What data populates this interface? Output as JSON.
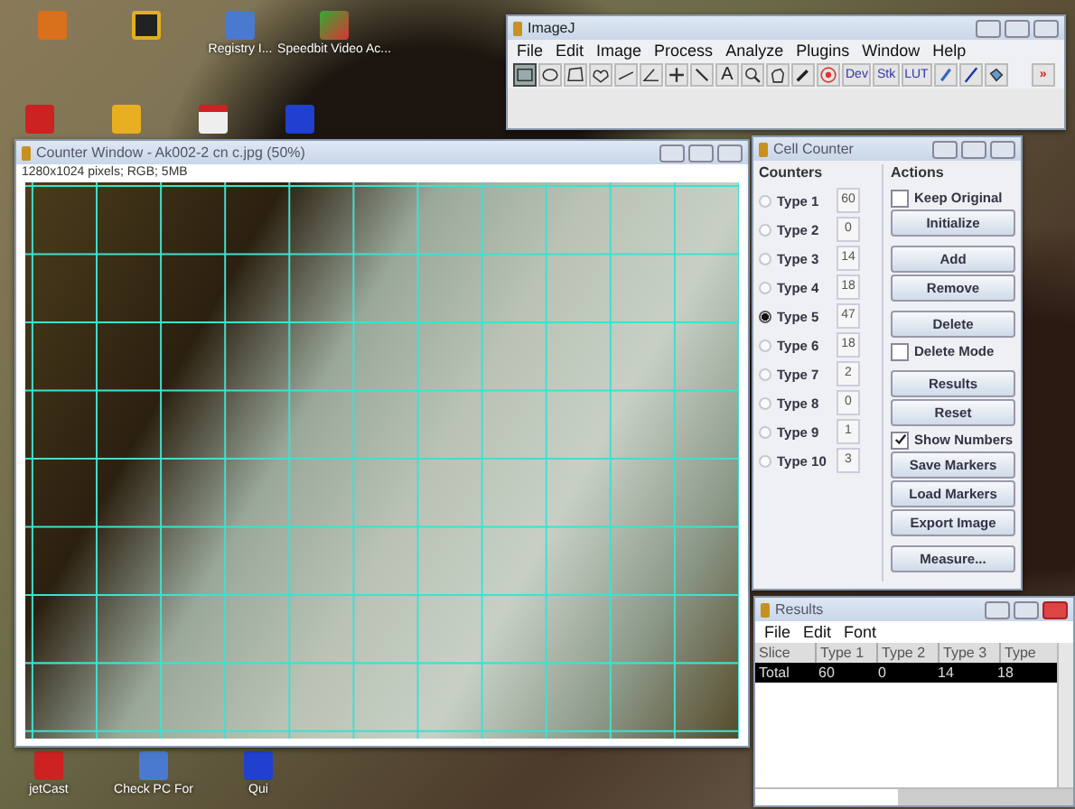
{
  "desktop": {
    "top_icons": [
      {
        "label": "Registry I..."
      },
      {
        "label": "Speedbit Video Ac..."
      }
    ],
    "bottom_icons": [
      {
        "label": "jetCast"
      },
      {
        "label": "Check PC For"
      },
      {
        "label": "Qui"
      }
    ]
  },
  "imagej": {
    "title": "ImageJ",
    "menu": [
      "File",
      "Edit",
      "Image",
      "Process",
      "Analyze",
      "Plugins",
      "Window",
      "Help"
    ],
    "tools": [
      {
        "kind": "rect",
        "selected": true
      },
      {
        "kind": "oval",
        "selected": false
      },
      {
        "kind": "polygon",
        "selected": false
      },
      {
        "kind": "freehand",
        "selected": false
      },
      {
        "kind": "line",
        "selected": false
      },
      {
        "kind": "angle",
        "selected": false
      },
      {
        "kind": "point",
        "selected": false
      },
      {
        "kind": "wand",
        "selected": false
      },
      {
        "kind": "text",
        "label": "A",
        "selected": false
      },
      {
        "kind": "zoom",
        "selected": false
      },
      {
        "kind": "hand",
        "selected": false
      },
      {
        "kind": "dropper",
        "selected": false
      },
      {
        "kind": "target",
        "selected": false
      },
      {
        "kind": "menu",
        "label": "Dev",
        "selected": false
      },
      {
        "kind": "menu",
        "label": "Stk",
        "selected": false
      },
      {
        "kind": "menu",
        "label": "LUT",
        "selected": false
      },
      {
        "kind": "brush",
        "selected": false
      },
      {
        "kind": "pen",
        "selected": false
      },
      {
        "kind": "bucket",
        "selected": false
      },
      {
        "kind": "more",
        "label": "»",
        "selected": false
      }
    ]
  },
  "image_window": {
    "title": "Counter Window - Ak002-2 cn c.jpg (50%)",
    "info": "1280x1024 pixels; RGB; 5MB"
  },
  "cell_counter": {
    "title": "Cell Counter",
    "counters_heading": "Counters",
    "actions_heading": "Actions",
    "counters": [
      {
        "label": "Type 1",
        "count": "60",
        "selected": false
      },
      {
        "label": "Type 2",
        "count": "0",
        "selected": false
      },
      {
        "label": "Type 3",
        "count": "14",
        "selected": false
      },
      {
        "label": "Type 4",
        "count": "18",
        "selected": false
      },
      {
        "label": "Type 5",
        "count": "47",
        "selected": true
      },
      {
        "label": "Type 6",
        "count": "18",
        "selected": false
      },
      {
        "label": "Type 7",
        "count": "2",
        "selected": false
      },
      {
        "label": "Type 8",
        "count": "0",
        "selected": false
      },
      {
        "label": "Type 9",
        "count": "1",
        "selected": false
      },
      {
        "label": "Type 10",
        "count": "3",
        "selected": false
      }
    ],
    "action_groups": [
      [
        {
          "kind": "checkbox",
          "label": "Keep Original",
          "checked": false
        },
        {
          "kind": "button",
          "label": "Initialize"
        }
      ],
      [
        {
          "kind": "button",
          "label": "Add"
        },
        {
          "kind": "button",
          "label": "Remove"
        }
      ],
      [
        {
          "kind": "button",
          "label": "Delete"
        },
        {
          "kind": "checkbox",
          "label": "Delete Mode",
          "checked": false
        }
      ],
      [
        {
          "kind": "button",
          "label": "Results"
        },
        {
          "kind": "button",
          "label": "Reset"
        },
        {
          "kind": "checkbox",
          "label": "Show Numbers",
          "checked": true
        },
        {
          "kind": "button",
          "label": "Save Markers"
        },
        {
          "kind": "button",
          "label": "Load Markers"
        },
        {
          "kind": "button",
          "label": "Export Image"
        }
      ],
      [
        {
          "kind": "button",
          "label": "Measure..."
        }
      ]
    ]
  },
  "results": {
    "title": "Results",
    "menu": [
      "File",
      "Edit",
      "Font"
    ],
    "columns": [
      "Slice",
      "Type 1",
      "Type 2",
      "Type 3",
      "Type"
    ],
    "rows": [
      {
        "cells": [
          "Total",
          "60",
          "0",
          "14",
          "18"
        ],
        "selected": true
      }
    ]
  }
}
